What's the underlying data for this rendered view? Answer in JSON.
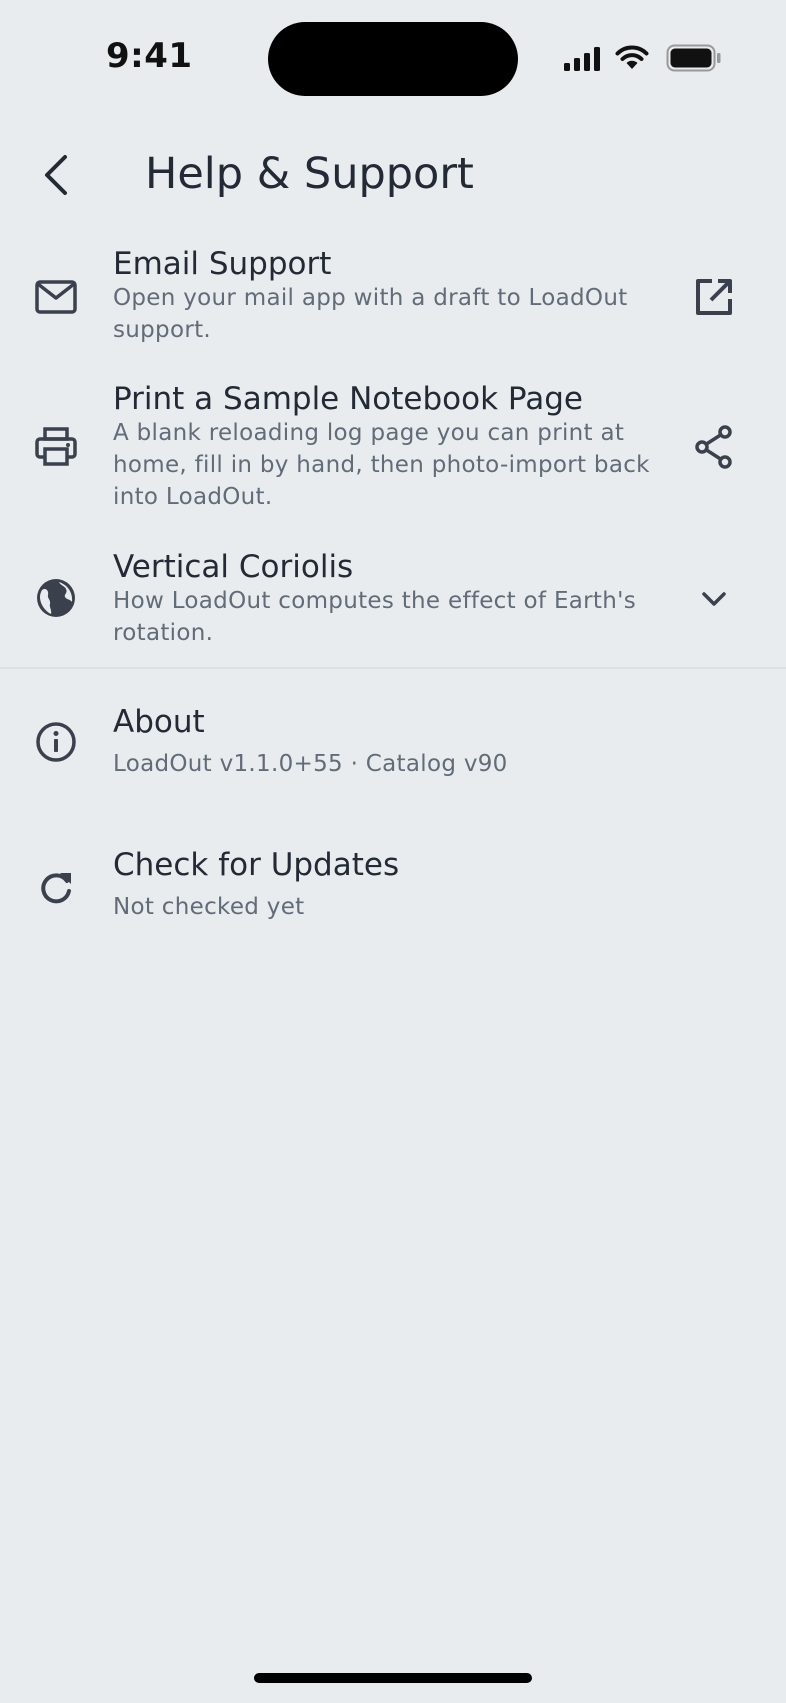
{
  "status_bar": {
    "time": "9:41"
  },
  "header": {
    "title": "Help & Support"
  },
  "items": [
    {
      "icon": "mail-icon",
      "title": "Email Support",
      "subtitle": "Open your mail app with a draft to LoadOut support.",
      "trailing_icon": "open-external-icon"
    },
    {
      "icon": "printer-icon",
      "title": "Print a Sample Notebook Page",
      "subtitle": "A blank reloading log page you can print at home, fill in by hand, then photo-import back into LoadOut.",
      "trailing_icon": "share-icon"
    },
    {
      "icon": "globe-icon",
      "title": "Vertical Coriolis",
      "subtitle": "How LoadOut computes the effect of Earth's rotation.",
      "trailing_icon": "chevron-down-icon"
    },
    {
      "icon": "info-icon",
      "title": "About",
      "subtitle": "LoadOut v1.1.0+55 · Catalog v90"
    },
    {
      "icon": "refresh-icon",
      "title": "Check for Updates",
      "subtitle": "Not checked yet"
    }
  ],
  "colors": {
    "background": "#e9ecef",
    "text_primary": "#232a36",
    "text_secondary": "#626b78",
    "icon": "#3a414d"
  }
}
